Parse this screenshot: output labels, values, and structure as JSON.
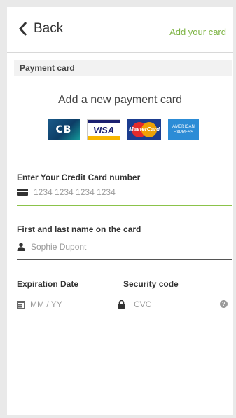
{
  "header": {
    "back_label": "Back",
    "title_action": "Add your card"
  },
  "section": {
    "label": "Payment card"
  },
  "main": {
    "heading": "Add a new payment card",
    "card_logos": {
      "cb": "CB",
      "visa": "VISA",
      "mastercard": "MasterCard",
      "amex_line1": "AMERICAN",
      "amex_line2": "EXPRESS"
    }
  },
  "form": {
    "card_number": {
      "label": "Enter Your Credit Card number",
      "placeholder": "1234 1234 1234 1234"
    },
    "name": {
      "label": "First and last name on the card",
      "placeholder": "Sophie Dupont"
    },
    "expiration": {
      "label": "Expiration Date",
      "placeholder": "MM / YY"
    },
    "security": {
      "label": "Security code",
      "placeholder": "CVC",
      "help": "?"
    }
  },
  "colors": {
    "accent": "#7cb342",
    "active_underline": "#8bc34a",
    "text": "#333333",
    "placeholder": "#9a9a9a"
  }
}
